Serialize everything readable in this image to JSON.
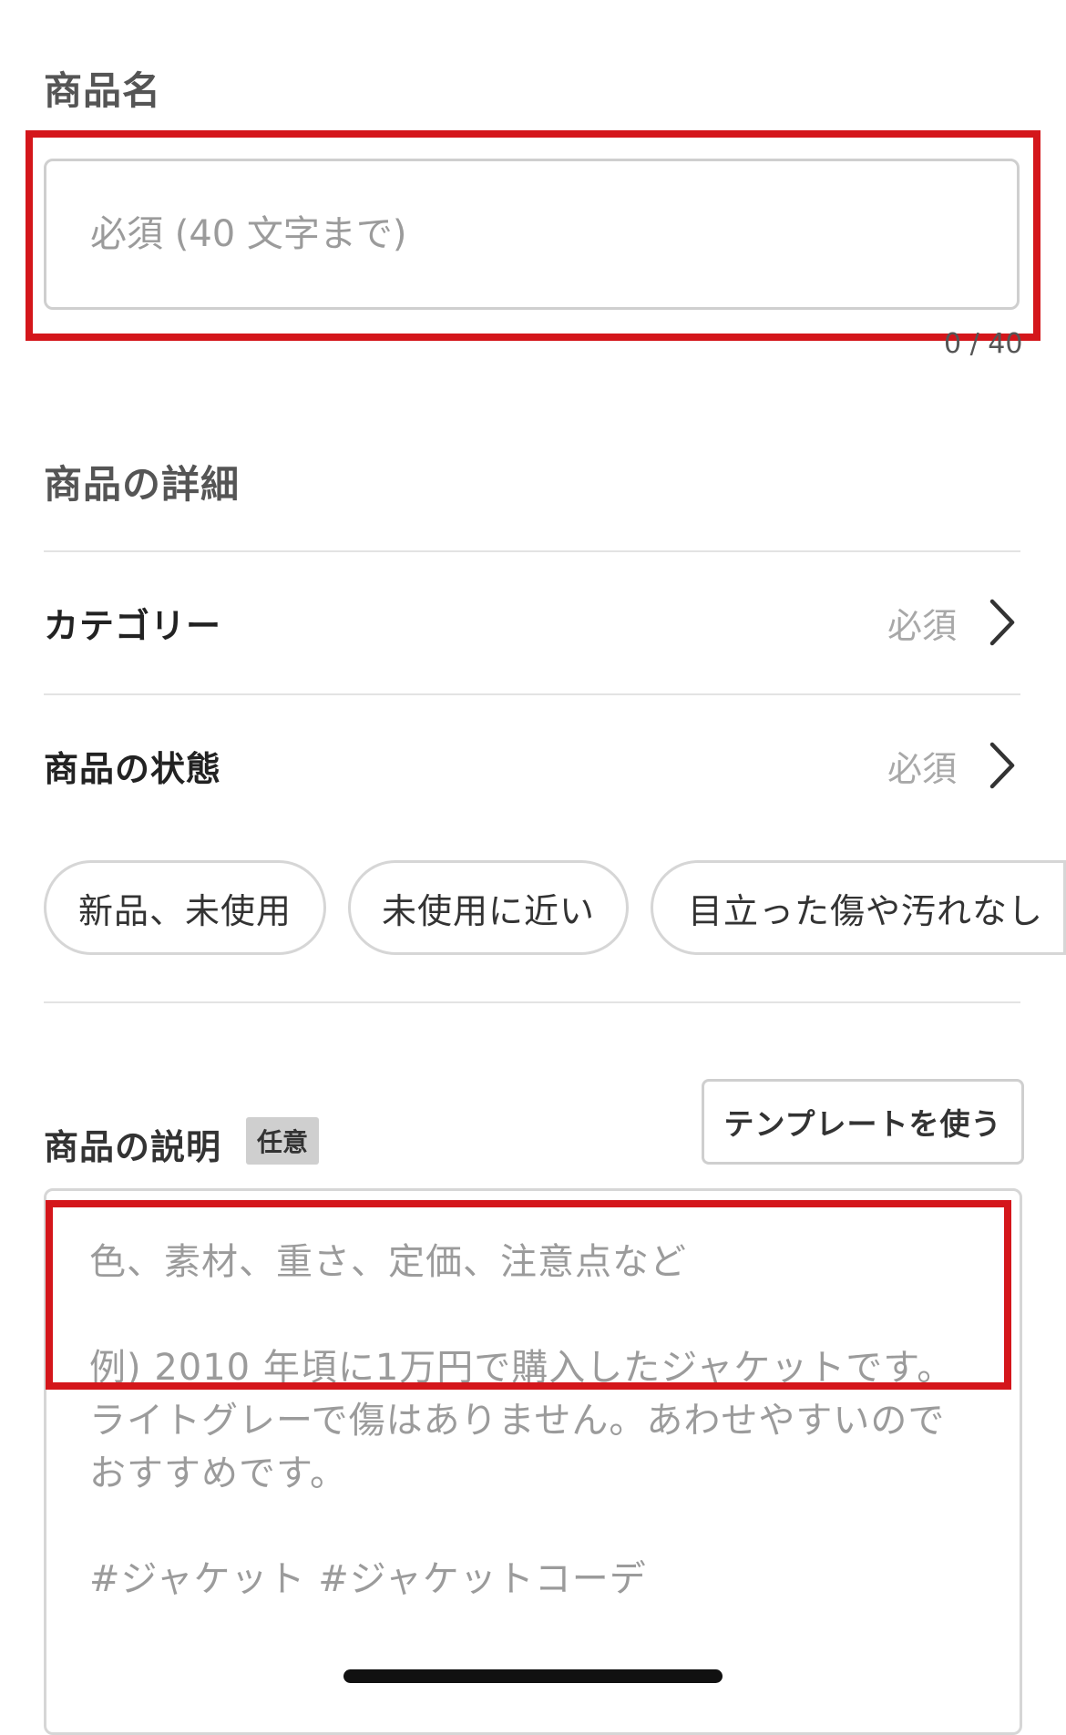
{
  "item_name": {
    "title": "商品名",
    "placeholder": "必須 (40 文字まで)",
    "counter": "0 / 40"
  },
  "details": {
    "title": "商品の詳細",
    "category": {
      "label": "カテゴリー",
      "required": "必須"
    },
    "condition": {
      "label": "商品の状態",
      "required": "必須"
    },
    "condition_chips": [
      "新品、未使用",
      "未使用に近い",
      "目立った傷や汚れなし"
    ]
  },
  "description": {
    "label": "商品の説明",
    "badge": "任意",
    "template_button": "テンプレートを使う",
    "placeholder_lines": [
      "色、素材、重さ、定価、注意点など",
      "例) 2010 年頃に1万円で購入したジャケットです。",
      "ライトグレーで傷はありません。あわせやすいので",
      "おすすめです。",
      "#ジャケット #ジャケットコーデ"
    ]
  },
  "colors": {
    "highlight": "#d4161b",
    "border": "#cfcfcf",
    "placeholder": "#9b9b9b"
  }
}
